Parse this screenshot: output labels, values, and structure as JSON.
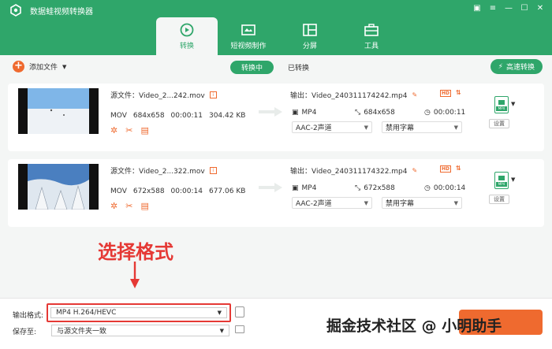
{
  "app": {
    "title": "数据蛙视频转换器"
  },
  "main_tabs": [
    {
      "label": "转换",
      "icon": "convert-icon",
      "active": true
    },
    {
      "label": "短视频制作",
      "icon": "film-icon",
      "active": false
    },
    {
      "label": "分屏",
      "icon": "split-screen-icon",
      "active": false
    },
    {
      "label": "工具",
      "icon": "toolbox-icon",
      "active": false
    }
  ],
  "toolbar": {
    "add_file": "添加文件",
    "tab_converting": "转换中",
    "tab_converted": "已转换",
    "fast_convert": "高速转换"
  },
  "files": [
    {
      "source": "源文件：Video_2...242.mov",
      "format": "MOV",
      "resolution": "684x658",
      "duration": "00:00:11",
      "size": "304.42 KB",
      "output_name": "输出：Video_240311174242.mp4",
      "out_format": "MP4",
      "out_resolution": "684x658",
      "out_duration": "00:00:11",
      "audio": "AAC-2声道",
      "subtitle": "禁用字幕",
      "settings": "设置"
    },
    {
      "source": "源文件：Video_2...322.mov",
      "format": "MOV",
      "resolution": "672x588",
      "duration": "00:00:14",
      "size": "677.06 KB",
      "output_name": "输出：Video_240311174322.mp4",
      "out_format": "MP4",
      "out_resolution": "672x588",
      "out_duration": "00:00:14",
      "audio": "AAC-2声道",
      "subtitle": "禁用字幕",
      "settings": "设置"
    }
  ],
  "annotation": {
    "text": "选择格式"
  },
  "footer": {
    "output_format_label": "输出格式:",
    "output_format_value": "MP4 H.264/HEVC",
    "save_to_label": "保存至:",
    "save_to_value": "与源文件夹一致",
    "watermark": "掘金技术社区 @ 小明助手"
  },
  "colors": {
    "brand": "#2fa66a",
    "accent": "#ef6a2f",
    "highlight": "#e53935"
  }
}
